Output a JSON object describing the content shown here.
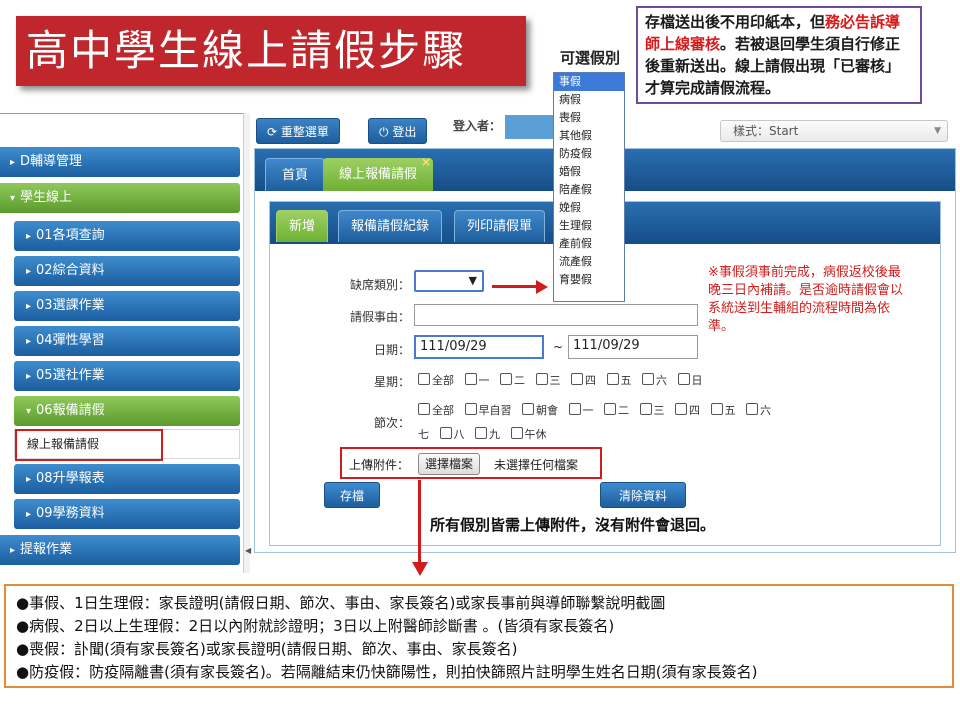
{
  "slide": {
    "title": "高中學生線上請假步驟",
    "note_part1": "存檔送出後不用印紙本，但",
    "note_red": "務必告訴導師上線審核",
    "note_part2": "。若被退回學生須自行修正後重新送出。線上請假出現「已審核」才算完成請假流程。"
  },
  "leave_types": {
    "label": "可選假別",
    "items": [
      "事假",
      "病假",
      "喪假",
      "其他假",
      "防疫假",
      "婚假",
      "陪產假",
      "娩假",
      "生理假",
      "產前假",
      "流產假",
      "育嬰假"
    ],
    "selected_index": 0
  },
  "topbar": {
    "reset_menu": "重整選單",
    "logout": "登出",
    "login_label": "登入者：",
    "style_label": "樣式：Start"
  },
  "sidebar": {
    "items": [
      {
        "label": "D輔導管理"
      },
      {
        "label": "學生線上"
      },
      {
        "label": "01各項查詢"
      },
      {
        "label": "02綜合資料"
      },
      {
        "label": "03選課作業"
      },
      {
        "label": "04彈性學習"
      },
      {
        "label": "05選社作業"
      },
      {
        "label": "06報備請假"
      },
      {
        "label": "線上報備請假"
      },
      {
        "label": "08升學報表"
      },
      {
        "label": "09學務資料"
      },
      {
        "label": "提報作業"
      }
    ]
  },
  "tabs": {
    "home": "首頁",
    "active": "線上報備請假",
    "close": "×"
  },
  "subtabs": {
    "add": "新增",
    "records": "報備請假紀錄",
    "print": "列印請假單"
  },
  "form": {
    "absence_type_label": "缺席類別：",
    "reason_label": "請假事由：",
    "date_label": "日期：",
    "date_from": "111/09/29",
    "date_sep": "~",
    "date_to": "111/09/29",
    "weekday_label": "星期：",
    "weekdays": [
      "全部",
      "一",
      "二",
      "三",
      "四",
      "五",
      "六",
      "日"
    ],
    "period_label": "節次：",
    "periods_row1": [
      "全部",
      "早自習",
      "朝會",
      "一",
      "二",
      "三",
      "四",
      "五",
      "六"
    ],
    "periods_row2": [
      "七",
      "八",
      "九",
      "午休"
    ],
    "attach_label": "上傳附件：",
    "choose_file": "選擇檔案",
    "no_file": "未選擇任何檔案",
    "save": "存檔",
    "clear": "清除資料"
  },
  "notes": {
    "advance": "※事假須事前完成，病假返校後最晚三日內補請。是否逾時請假會以系統送到生輔組的流程時間為依準。",
    "attach_required": "所有假別皆需上傳附件，沒有附件會退回。"
  },
  "rules": [
    "●事假、1日生理假：家長證明(請假日期、節次、事由、家長簽名)或家長事前與導師聯繫說明截圖",
    "●病假、2日以上生理假：2日以內附就診證明；3日以上附醫師診斷書 。(皆須有家長簽名)",
    "●喪假：訃聞(須有家長簽名)或家長證明(請假日期、節次、事由、家長簽名)",
    "●防疫假：防疫隔離書(須有家長簽名)。若隔離結束仍快篩陽性，則拍快篩照片註明學生姓名日期(須有家長簽名)"
  ],
  "colors": {
    "title_red": "#c0272d",
    "accent_red": "#d01c1c",
    "menu_blue": "#1d5e9e",
    "menu_green": "#6fb034",
    "note_border": "#6e4b9c",
    "rules_border": "#e48b3a"
  }
}
